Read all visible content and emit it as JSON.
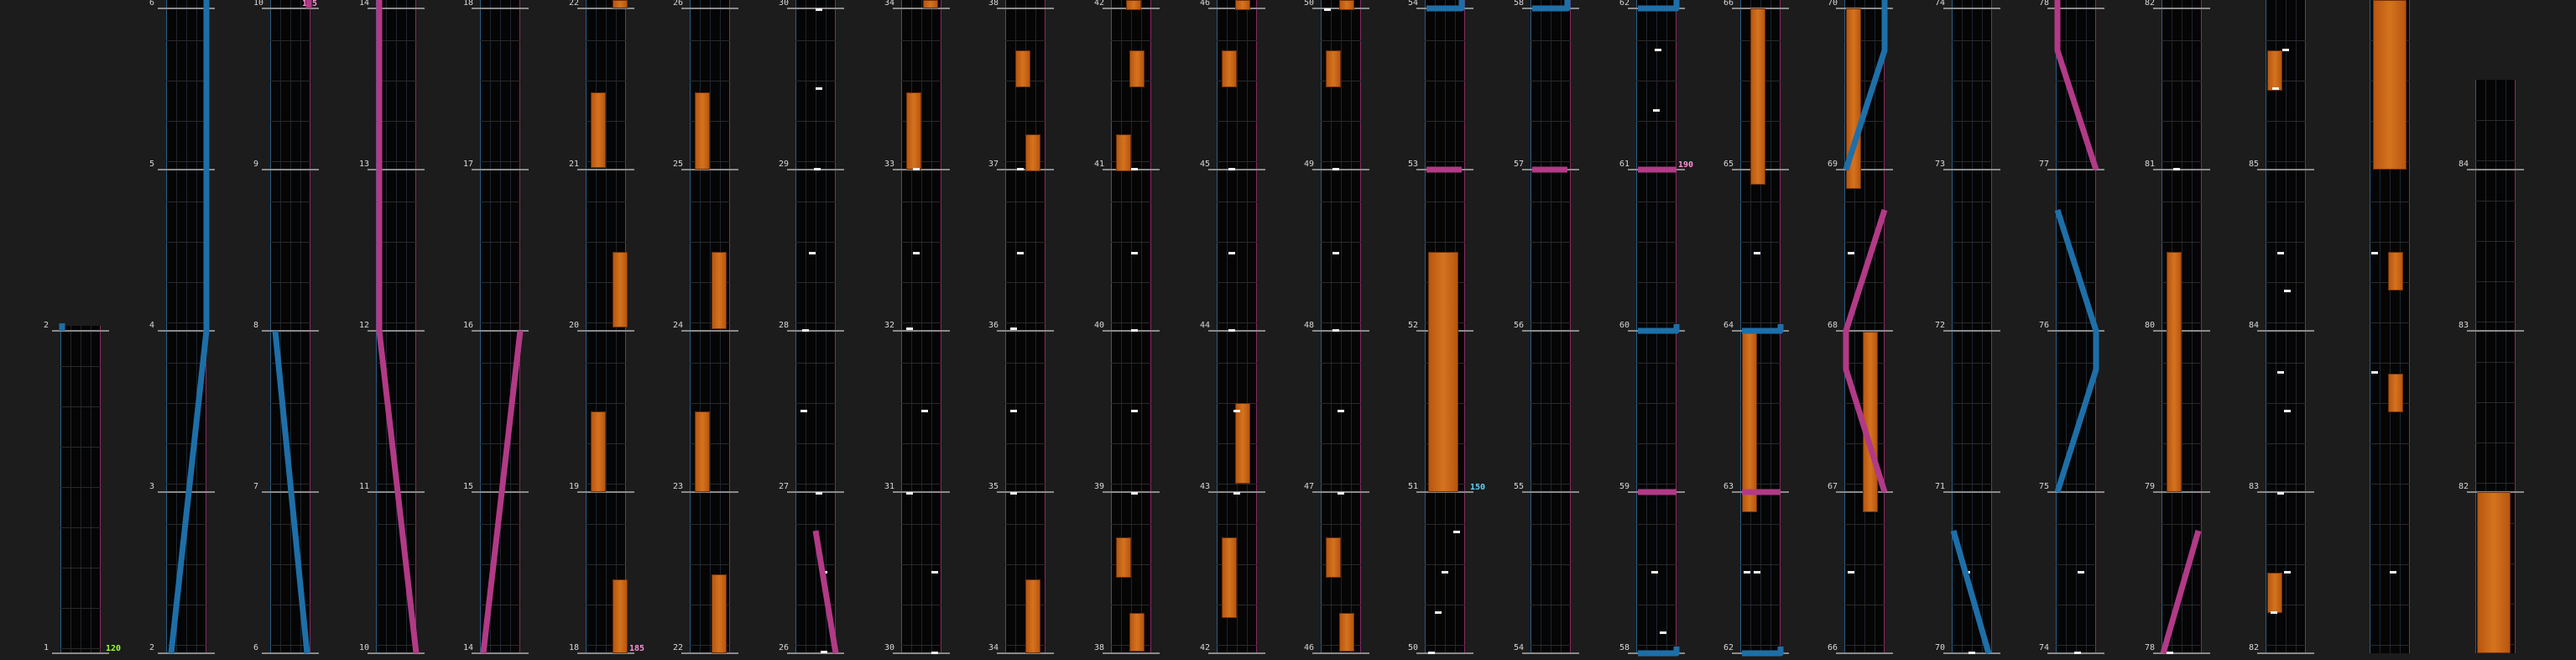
{
  "chart_view": {
    "measures": [
      "1",
      "2",
      "3",
      "4",
      "5",
      "6",
      "7",
      "8",
      "9",
      "10",
      "11",
      "12",
      "13",
      "14",
      "15",
      "16",
      "17",
      "18",
      "19",
      "20",
      "21",
      "22",
      "23",
      "24",
      "25",
      "26",
      "27",
      "28",
      "29",
      "30",
      "31",
      "32",
      "33",
      "34",
      "35",
      "36",
      "37",
      "38",
      "39",
      "40",
      "41",
      "42",
      "43",
      "44",
      "45",
      "46",
      "47",
      "48",
      "49",
      "50",
      "51",
      "52",
      "53",
      "54",
      "55",
      "56",
      "57",
      "58",
      "59",
      "60",
      "61",
      "62",
      "63",
      "64",
      "65",
      "66",
      "67",
      "68",
      "69",
      "70",
      "71",
      "72",
      "73",
      "74",
      "75",
      "76",
      "77",
      "78",
      "79",
      "80",
      "81",
      "82",
      "83",
      "84",
      "85"
    ],
    "bpm_markers": [
      {
        "label": "120",
        "color": "#9cff2e"
      },
      {
        "label": "185",
        "color": "#ff8fd6"
      },
      {
        "label": "185",
        "color": "#ff8fd6"
      },
      {
        "label": "150",
        "color": "#5fd2ff"
      },
      {
        "label": "190",
        "color": "#ff8fd6"
      }
    ],
    "colors": {
      "background": "#1c1c1c",
      "lane_blue": "#1e6fa8",
      "lane_pink": "#b23a86",
      "hold": "#d4741f",
      "note": "#f2f2f2"
    }
  }
}
